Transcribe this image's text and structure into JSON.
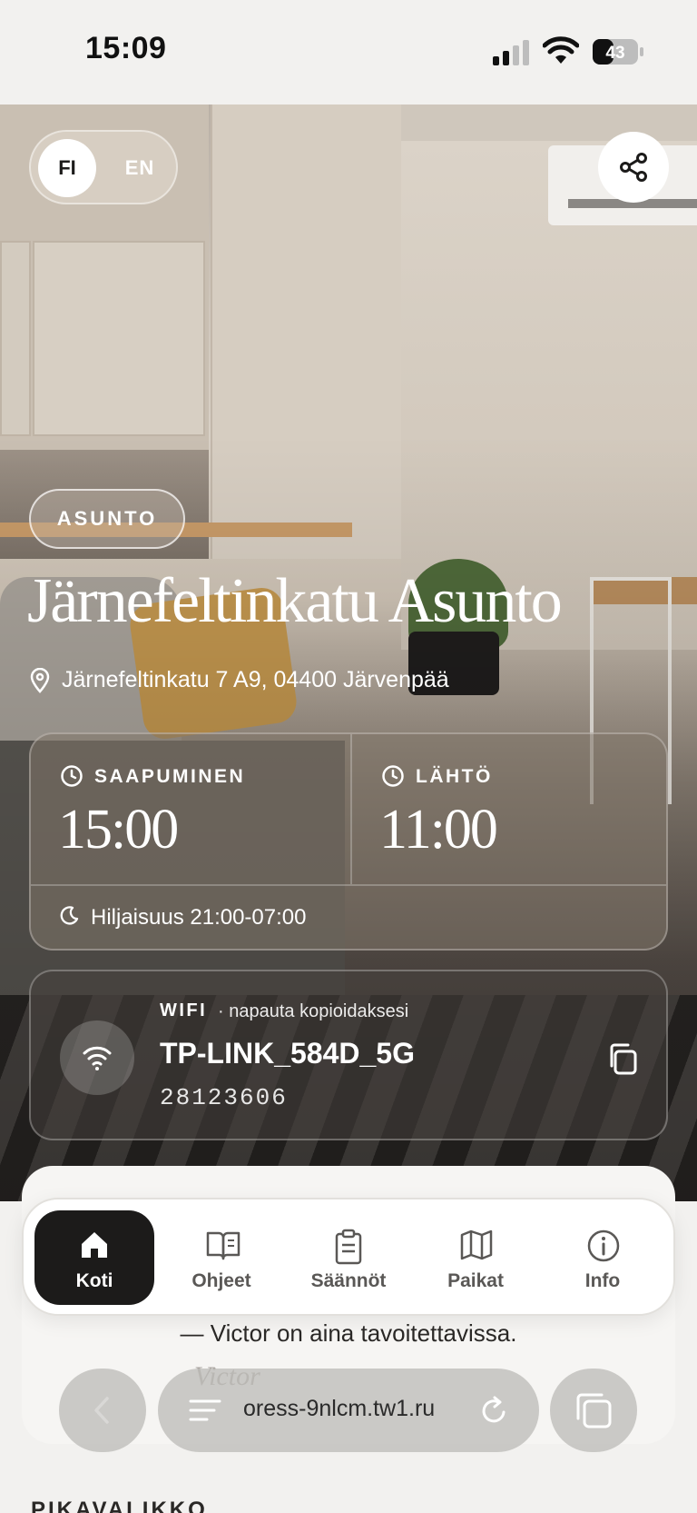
{
  "status_bar": {
    "time": "15:09",
    "battery": "43"
  },
  "header": {
    "lang_fi": "FI",
    "lang_en": "EN",
    "active_lang": "FI"
  },
  "property": {
    "badge": "ASUNTO",
    "title": "Järnefeltinkatu Asunto",
    "address": "Järnefeltinkatu 7 A9, 04400 Järvenpää"
  },
  "times": {
    "checkin_label": "SAAPUMINEN",
    "checkin_time": "15:00",
    "checkout_label": "LÄHTÖ",
    "checkout_time": "11:00",
    "quiet_hours": "Hiljaisuus 21:00-07:00"
  },
  "wifi": {
    "label": "WIFI",
    "hint": "· napauta kopioidaksesi",
    "ssid": "TP-LINK_584D_5G",
    "password": "28123606"
  },
  "tabbar": {
    "items": [
      {
        "label": "Koti",
        "icon": "home-icon",
        "active": true
      },
      {
        "label": "Ohjeet",
        "icon": "book-icon",
        "active": false
      },
      {
        "label": "Säännöt",
        "icon": "clipboard-icon",
        "active": false
      },
      {
        "label": "Paikat",
        "icon": "map-icon",
        "active": false
      },
      {
        "label": "Info",
        "icon": "info-icon",
        "active": false
      }
    ]
  },
  "footer": {
    "note": "— Victor on aina tavoitettavissa.",
    "signature": "Victor"
  },
  "browser": {
    "url": "oress-9nlcm.tw1.ru"
  },
  "section": {
    "quick_menu_title": "PIKAVALIKKO"
  },
  "colors": {
    "accent_dark": "#1c1b1a",
    "background": "#f2f1ef"
  }
}
